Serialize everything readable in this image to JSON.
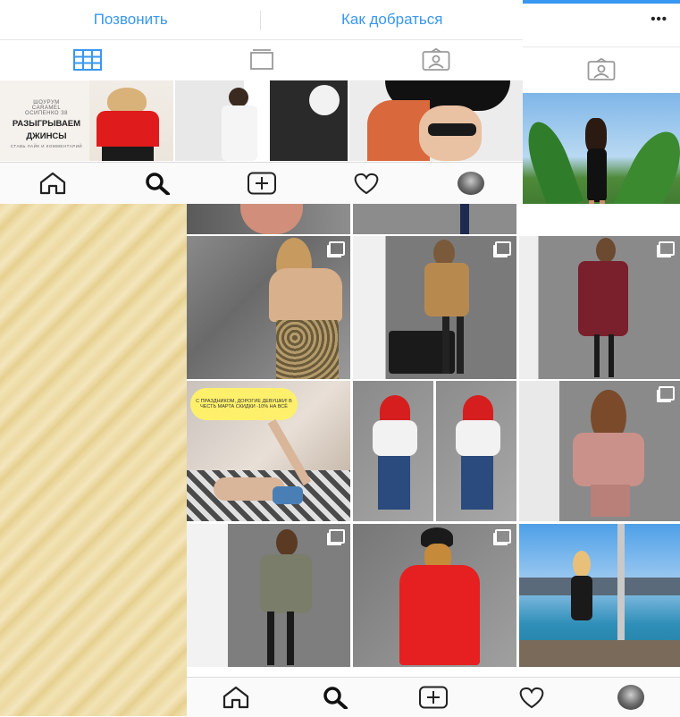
{
  "profile_actions": {
    "call_label": "Позвонить",
    "directions_label": "Как добраться"
  },
  "top_right": {
    "more_label": "•••"
  },
  "promo_post": {
    "line1": "ШОУРУМ",
    "line2": "CARAMEL",
    "line3": "ОСИПЕНКО 38",
    "headline1": "РАЗЫГРЫВАЕМ",
    "headline2": "ДЖИНСЫ",
    "footer": "СТАВЬ ЛАЙК И КОММЕНТАРИЙ"
  },
  "caption_bubble": {
    "text": "С ПРАЗДНИКОМ, ДОРОГИЕ ДЕВУШКИ! В ЧЕСТЬ МАРТА СКИДКИ -10% НА ВСЁ"
  },
  "colors": {
    "accent": "#3897f0",
    "beige": "#ecd9a2",
    "nav_bg": "#fafafa"
  },
  "icons": {
    "tabs": [
      "grid-icon",
      "igtv-icon",
      "tagged-icon"
    ],
    "nav": [
      "home-icon",
      "search-icon",
      "add-post-icon",
      "heart-icon",
      "profile-avatar"
    ]
  }
}
